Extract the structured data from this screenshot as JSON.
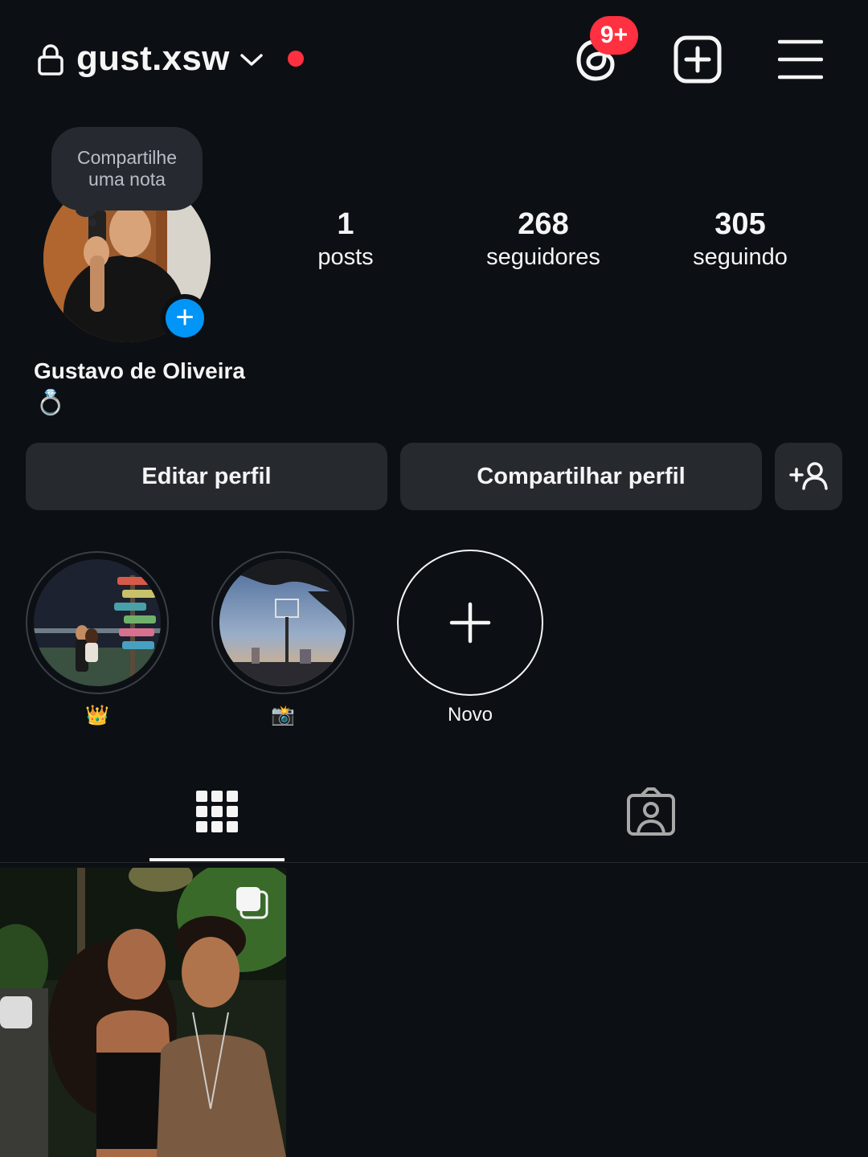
{
  "header": {
    "username": "gust.xsw",
    "notification_badge": "9+",
    "icons": [
      "lock-icon",
      "chevron-down-icon",
      "threads-icon",
      "create-icon",
      "menu-icon"
    ],
    "live_dot_color": "#ff3040"
  },
  "note": {
    "text_line1": "Compartilhe",
    "text_line2": "uma nota"
  },
  "stats": [
    {
      "value": "1",
      "label": "posts"
    },
    {
      "value": "268",
      "label": "seguidores"
    },
    {
      "value": "305",
      "label": "seguindo"
    }
  ],
  "profile": {
    "full_name": "Gustavo de Oliveira",
    "bio": "💍"
  },
  "actions": {
    "edit_label": "Editar perfil",
    "share_label": "Compartilhar perfil"
  },
  "highlights": [
    {
      "label": "👑"
    },
    {
      "label": "📸"
    },
    {
      "label": "Novo"
    }
  ],
  "colors": {
    "background": "#0c1014",
    "button": "#262a2f",
    "accent_blue": "#0095f6",
    "badge_red": "#ff3040"
  }
}
